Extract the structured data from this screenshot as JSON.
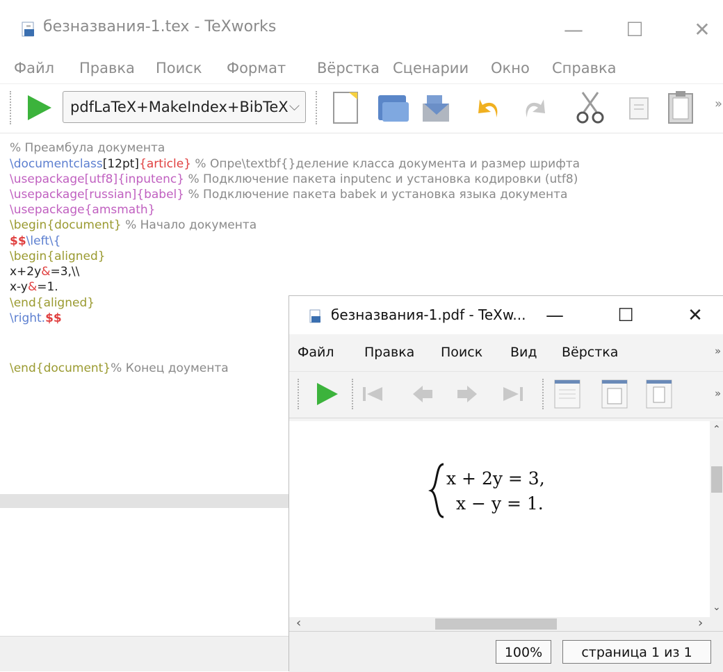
{
  "main_window": {
    "title": "безназвания-1.tex - TeXworks",
    "menu": [
      "Файл",
      "Правка",
      "Поиск",
      "Формат",
      "Вёрстка",
      "Сценарии",
      "Окно",
      "Справка"
    ],
    "engine": "pdfLaTeX+MakeIndex+BibTeX",
    "overflow": "»",
    "code": {
      "l1": "% Преамбула документа",
      "l2_cmd": "\\documentclass",
      "l2_opt": "[12pt]",
      "l2_arg": "{article}",
      "l2_comment": " % Опре\\textbf{}деление класса документа и размер шрифта",
      "l3_cmd": "\\usepackage",
      "l3_args": "[utf8]{inputenc}",
      "l3_comment": " % Подключение пакета inputenc и установка кодировки (utf8)",
      "l4_cmd": "\\usepackage",
      "l4_args": "[russian]{babel}",
      "l4_comment": " % Подключение пакета babek и установка языка документа",
      "l5_cmd": "\\usepackage",
      "l5_args": "{amsmath}",
      "l6_env": "\\begin{document}",
      "l6_comment": " % Начало документа",
      "l7_dollar": "$$",
      "l7_cmd": "\\left\\{",
      "l8_env": "\\begin{aligned}",
      "l9_a": "x+2y",
      "l9_amp": "&",
      "l9_b": "=3,\\\\",
      "l10_a": "x-y",
      "l10_amp": "&",
      "l10_b": "=1.",
      "l11_env": "\\end{aligned}",
      "l12_cmd": "\\right.",
      "l12_dollar": "$$",
      "l13_env": "\\end{document}",
      "l13_comment": "% Конец доумента"
    }
  },
  "pdf_window": {
    "title": "безназвания-1.pdf - TeXw...",
    "menu": [
      "Файл",
      "Правка",
      "Поиск",
      "Вид",
      "Вёрстка"
    ],
    "overflow": "»",
    "math_line1": "x + 2y = 3,",
    "math_line2": "x − y = 1.",
    "zoom": "100%",
    "page": "страница 1 из 1"
  }
}
